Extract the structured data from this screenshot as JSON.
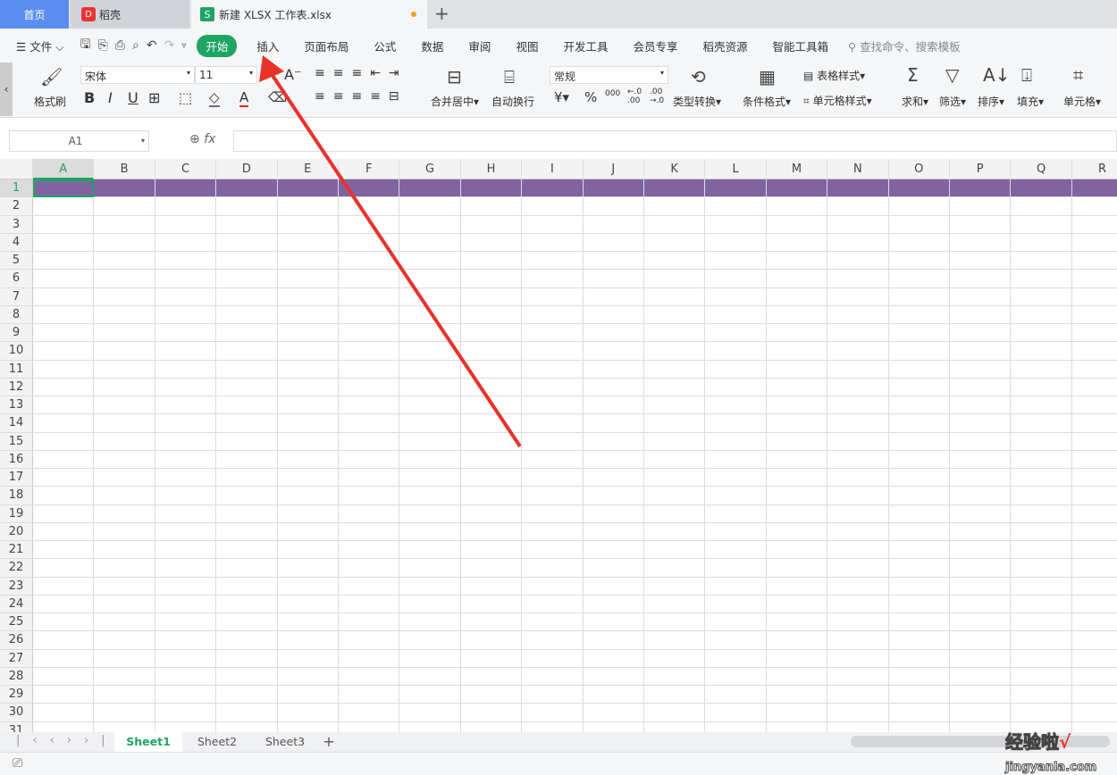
{
  "tabs": {
    "home": "首页",
    "docer": "稻壳",
    "file": "新建 XLSX 工作表.xlsx",
    "new": "+"
  },
  "menu": {
    "file": "文件",
    "items": [
      "开始",
      "插入",
      "页面布局",
      "公式",
      "数据",
      "审阅",
      "视图",
      "开发工具",
      "会员专享",
      "稻壳资源",
      "智能工具箱"
    ],
    "active": "开始",
    "search_placeholder": "查找命令、搜索模板"
  },
  "ribbon": {
    "format_painter": "格式刷",
    "font": "宋体",
    "size": "11",
    "merge": "合并居中",
    "wrap": "自动换行",
    "number_format": "常规",
    "currency": "¥",
    "percent": "%",
    "type_convert": "类型转换",
    "cond_format": "条件格式",
    "table_style": "表格样式",
    "cell_style": "单元格样式",
    "sum": "求和",
    "filter": "筛选",
    "sort": "排序",
    "fill": "填充",
    "cell": "单元格"
  },
  "formula": {
    "name_box": "A1",
    "fx": "fx",
    "value": ""
  },
  "grid": {
    "columns": [
      "A",
      "B",
      "C",
      "D",
      "E",
      "F",
      "G",
      "H",
      "I",
      "J",
      "K",
      "L",
      "M",
      "N",
      "O",
      "P",
      "Q",
      "R"
    ],
    "rows": 31,
    "selected": "A1",
    "row1_fill": "#8064a2"
  },
  "sheets": {
    "tabs": [
      "Sheet1",
      "Sheet2",
      "Sheet3"
    ],
    "active": "Sheet1",
    "add": "+"
  },
  "watermark": "经验啦 jingyanla.com",
  "annotation_color": "#e8322a"
}
